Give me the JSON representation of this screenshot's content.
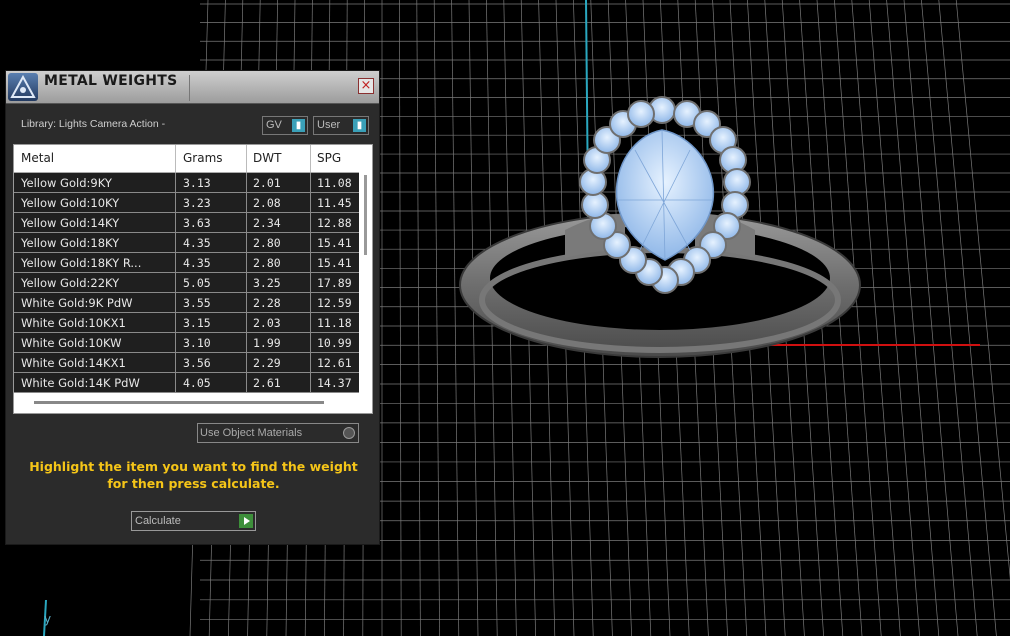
{
  "panel": {
    "title": "METAL WEIGHTS",
    "close_glyph": "×",
    "library_label": "Library: Lights Camera Action -",
    "gv_select": "GV",
    "user_select": "User",
    "table": {
      "headers": [
        "Metal",
        "Grams",
        "DWT",
        "SPG"
      ],
      "rows": [
        [
          "Yellow Gold:9KY",
          "3.13",
          "2.01",
          "11.08"
        ],
        [
          "Yellow Gold:10KY",
          "3.23",
          "2.08",
          "11.45"
        ],
        [
          "Yellow Gold:14KY",
          "3.63",
          "2.34",
          "12.88"
        ],
        [
          "Yellow Gold:18KY",
          "4.35",
          "2.80",
          "15.41"
        ],
        [
          "Yellow Gold:18KY R...",
          "4.35",
          "2.80",
          "15.41"
        ],
        [
          "Yellow Gold:22KY",
          "5.05",
          "3.25",
          "17.89"
        ],
        [
          "White Gold:9K PdW",
          "3.55",
          "2.28",
          "12.59"
        ],
        [
          "White Gold:10KX1",
          "3.15",
          "2.03",
          "11.18"
        ],
        [
          "White Gold:10KW",
          "3.10",
          "1.99",
          "10.99"
        ],
        [
          "White Gold:14KX1",
          "3.56",
          "2.29",
          "12.61"
        ],
        [
          "White Gold:14K PdW",
          "4.05",
          "2.61",
          "14.37"
        ]
      ]
    },
    "use_object_materials": "Use Object Materials",
    "hint": "Highlight the item you want to find the weight for then press calculate.",
    "calculate_label": "Calculate"
  },
  "viewport": {
    "axis_label": "y"
  },
  "colors": {
    "hint": "#f5c518",
    "axis_x": "#d01010",
    "axis_y": "#2aa8c0",
    "gem": "#b8d8f8"
  }
}
